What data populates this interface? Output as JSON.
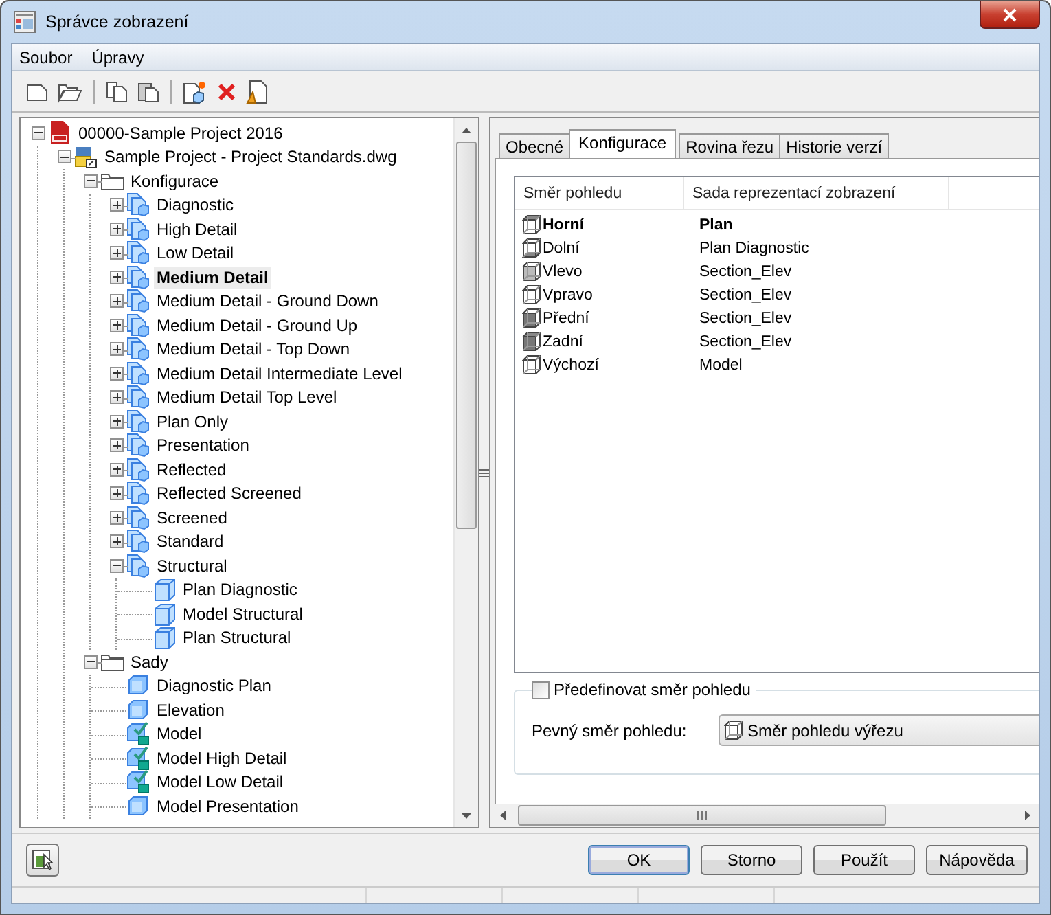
{
  "window": {
    "title": "Správce zobrazení"
  },
  "menu": [
    "Soubor",
    "Úpravy"
  ],
  "tree": [
    {
      "label": "00000-Sample Project 2016",
      "kind": "project",
      "expanded": true,
      "selected": false,
      "children": [
        {
          "label": "Sample Project - Project Standards.dwg",
          "kind": "drawing",
          "expanded": true,
          "selected": false,
          "children": [
            {
              "label": "Konfigurace",
              "kind": "folder",
              "expanded": true,
              "selected": false,
              "children": [
                {
                  "label": "Diagnostic",
                  "kind": "config",
                  "expanded": false,
                  "selected": false
                },
                {
                  "label": "High Detail",
                  "kind": "config",
                  "expanded": false,
                  "selected": false
                },
                {
                  "label": "Low Detail",
                  "kind": "config",
                  "expanded": false,
                  "selected": false
                },
                {
                  "label": "Medium Detail",
                  "kind": "config",
                  "expanded": false,
                  "selected": true
                },
                {
                  "label": "Medium Detail - Ground Down",
                  "kind": "config",
                  "expanded": false,
                  "selected": false
                },
                {
                  "label": "Medium Detail - Ground Up",
                  "kind": "config",
                  "expanded": false,
                  "selected": false
                },
                {
                  "label": "Medium Detail - Top Down",
                  "kind": "config",
                  "expanded": false,
                  "selected": false
                },
                {
                  "label": "Medium Detail Intermediate Level",
                  "kind": "config",
                  "expanded": false,
                  "selected": false
                },
                {
                  "label": "Medium Detail Top Level",
                  "kind": "config",
                  "expanded": false,
                  "selected": false
                },
                {
                  "label": "Plan Only",
                  "kind": "config",
                  "expanded": false,
                  "selected": false
                },
                {
                  "label": "Presentation",
                  "kind": "config",
                  "expanded": false,
                  "selected": false
                },
                {
                  "label": "Reflected",
                  "kind": "config",
                  "expanded": false,
                  "selected": false
                },
                {
                  "label": "Reflected Screened",
                  "kind": "config",
                  "expanded": false,
                  "selected": false
                },
                {
                  "label": "Screened",
                  "kind": "config",
                  "expanded": false,
                  "selected": false
                },
                {
                  "label": "Standard",
                  "kind": "config",
                  "expanded": false,
                  "selected": false
                },
                {
                  "label": "Structural",
                  "kind": "config",
                  "expanded": true,
                  "selected": false,
                  "children": [
                    {
                      "label": "Plan Diagnostic",
                      "kind": "rep",
                      "selected": false
                    },
                    {
                      "label": "Model Structural",
                      "kind": "rep",
                      "selected": false
                    },
                    {
                      "label": "Plan Structural",
                      "kind": "rep",
                      "selected": false
                    }
                  ]
                }
              ]
            },
            {
              "label": "Sady",
              "kind": "folder",
              "expanded": true,
              "selected": false,
              "children": [
                {
                  "label": "Diagnostic Plan",
                  "kind": "set",
                  "selected": false
                },
                {
                  "label": "Elevation",
                  "kind": "set",
                  "selected": false
                },
                {
                  "label": "Model",
                  "kind": "set-checked",
                  "selected": false
                },
                {
                  "label": "Model High Detail",
                  "kind": "set-checked",
                  "selected": false
                },
                {
                  "label": "Model Low Detail",
                  "kind": "set-checked",
                  "selected": false
                },
                {
                  "label": "Model Presentation",
                  "kind": "set",
                  "selected": false
                }
              ]
            }
          ]
        }
      ]
    }
  ],
  "tabs": [
    {
      "label": "Obecné",
      "selected": false
    },
    {
      "label": "Konfigurace",
      "selected": true
    },
    {
      "label": "Rovina řezu",
      "selected": false
    },
    {
      "label": "Historie verzí",
      "selected": false
    }
  ],
  "table": {
    "columns": [
      "Směr pohledu",
      "Sada reprezentací zobrazení"
    ],
    "rows": [
      {
        "view": "Horní",
        "rep": "Plan",
        "kind": "top",
        "active": true
      },
      {
        "view": "Dolní",
        "rep": "Plan Diagnostic",
        "kind": "bottom",
        "active": false
      },
      {
        "view": "Vlevo",
        "rep": "Section_Elev",
        "kind": "left",
        "active": false
      },
      {
        "view": "Vpravo",
        "rep": "Section_Elev",
        "kind": "right",
        "active": false
      },
      {
        "view": "Přední",
        "rep": "Section_Elev",
        "kind": "front",
        "active": false
      },
      {
        "view": "Zadní",
        "rep": "Section_Elev",
        "kind": "back",
        "active": false
      },
      {
        "view": "Výchozí",
        "rep": "Model",
        "kind": "default",
        "active": false
      }
    ]
  },
  "override": {
    "label": "Předefinovat směr pohledu",
    "checked": false,
    "field_label": "Pevný směr pohledu:",
    "value": "Směr pohledu výřezu"
  },
  "buttons": [
    {
      "label": "OK",
      "default": true
    },
    {
      "label": "Storno",
      "default": false
    },
    {
      "label": "Použít",
      "default": false
    },
    {
      "label": "Nápověda",
      "default": false
    }
  ]
}
